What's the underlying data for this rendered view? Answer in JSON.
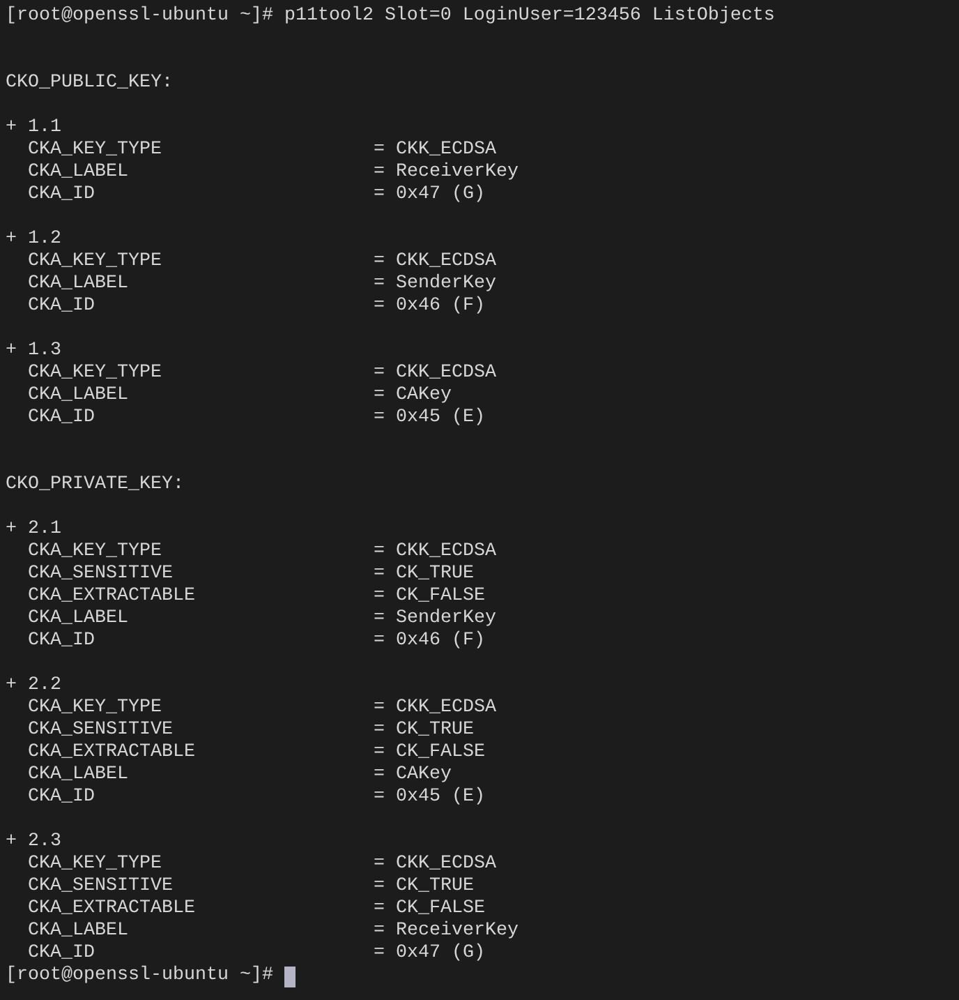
{
  "terminal": {
    "command_line": "[root@openssl-ubuntu ~]# p11tool2 Slot=0 LoginUser=123456 ListObjects",
    "sections": [
      {
        "header": "CKO_PUBLIC_KEY:",
        "objects": [
          {
            "label": "+ 1.1",
            "attributes": [
              {
                "name": "CKA_KEY_TYPE",
                "value": "= CKK_ECDSA"
              },
              {
                "name": "CKA_LABEL",
                "value": "= ReceiverKey"
              },
              {
                "name": "CKA_ID",
                "value": "= 0x47 (G)"
              }
            ]
          },
          {
            "label": "+ 1.2",
            "attributes": [
              {
                "name": "CKA_KEY_TYPE",
                "value": "= CKK_ECDSA"
              },
              {
                "name": "CKA_LABEL",
                "value": "= SenderKey"
              },
              {
                "name": "CKA_ID",
                "value": "= 0x46 (F)"
              }
            ]
          },
          {
            "label": "+ 1.3",
            "attributes": [
              {
                "name": "CKA_KEY_TYPE",
                "value": "= CKK_ECDSA"
              },
              {
                "name": "CKA_LABEL",
                "value": "= CAKey"
              },
              {
                "name": "CKA_ID",
                "value": "= 0x45 (E)"
              }
            ]
          }
        ]
      },
      {
        "header": "CKO_PRIVATE_KEY:",
        "objects": [
          {
            "label": "+ 2.1",
            "attributes": [
              {
                "name": "CKA_KEY_TYPE",
                "value": "= CKK_ECDSA"
              },
              {
                "name": "CKA_SENSITIVE",
                "value": "= CK_TRUE"
              },
              {
                "name": "CKA_EXTRACTABLE",
                "value": "= CK_FALSE"
              },
              {
                "name": "CKA_LABEL",
                "value": "= SenderKey"
              },
              {
                "name": "CKA_ID",
                "value": "= 0x46 (F)"
              }
            ]
          },
          {
            "label": "+ 2.2",
            "attributes": [
              {
                "name": "CKA_KEY_TYPE",
                "value": "= CKK_ECDSA"
              },
              {
                "name": "CKA_SENSITIVE",
                "value": "= CK_TRUE"
              },
              {
                "name": "CKA_EXTRACTABLE",
                "value": "= CK_FALSE"
              },
              {
                "name": "CKA_LABEL",
                "value": "= CAKey"
              },
              {
                "name": "CKA_ID",
                "value": "= 0x45 (E)"
              }
            ]
          },
          {
            "label": "+ 2.3",
            "attributes": [
              {
                "name": "CKA_KEY_TYPE",
                "value": "= CKK_ECDSA"
              },
              {
                "name": "CKA_SENSITIVE",
                "value": "= CK_TRUE"
              },
              {
                "name": "CKA_EXTRACTABLE",
                "value": "= CK_FALSE"
              },
              {
                "name": "CKA_LABEL",
                "value": "= ReceiverKey"
              },
              {
                "name": "CKA_ID",
                "value": "= 0x47 (G)"
              }
            ]
          }
        ]
      }
    ],
    "prompt": "[root@openssl-ubuntu ~]#"
  }
}
